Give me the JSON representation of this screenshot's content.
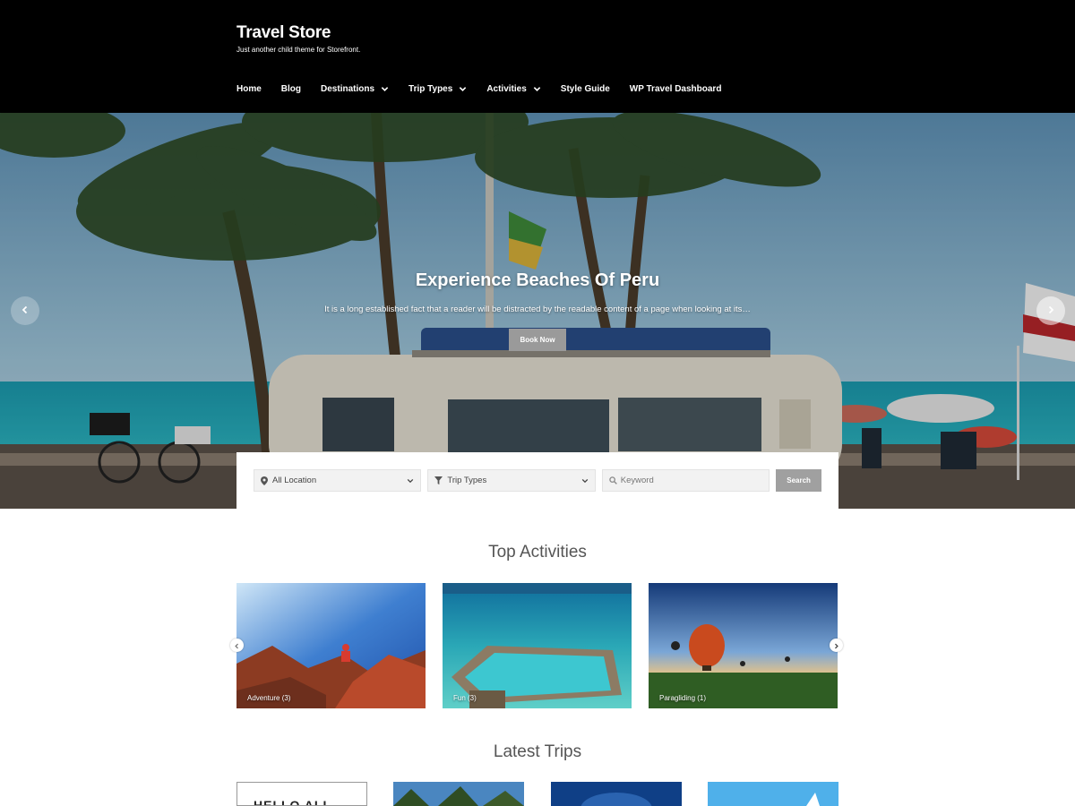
{
  "header": {
    "site_title": "Travel Store",
    "tagline": "Just another child theme for Storefront.",
    "nav": [
      {
        "label": "Home",
        "has_dropdown": false
      },
      {
        "label": "Blog",
        "has_dropdown": false
      },
      {
        "label": "Destinations",
        "has_dropdown": true
      },
      {
        "label": "Trip Types",
        "has_dropdown": true
      },
      {
        "label": "Activities",
        "has_dropdown": true
      },
      {
        "label": "Style Guide",
        "has_dropdown": false
      },
      {
        "label": "WP Travel Dashboard",
        "has_dropdown": false
      }
    ]
  },
  "hero": {
    "title": "Experience Beaches Of Peru",
    "text": "It is a long established fact that a reader will be distracted by the readable content of a page when looking at its…",
    "button_label": "Book Now",
    "prev_icon": "chevron-left-icon",
    "next_icon": "chevron-right-icon"
  },
  "search": {
    "location_value": "All Location",
    "trip_types_value": "Trip Types",
    "keyword_placeholder": "Keyword",
    "button_label": "Search"
  },
  "top_activities": {
    "title": "Top Activities",
    "items": [
      {
        "label": "Adventure (3)"
      },
      {
        "label": "Fun (3)"
      },
      {
        "label": "Paragliding (1)"
      }
    ]
  },
  "latest_trips": {
    "title": "Latest Trips",
    "first_card_text": "HELLO ALL"
  },
  "colors": {
    "header_bg": "#000000",
    "button_gray": "#9a9a9a",
    "input_bg": "#f2f2f2"
  }
}
